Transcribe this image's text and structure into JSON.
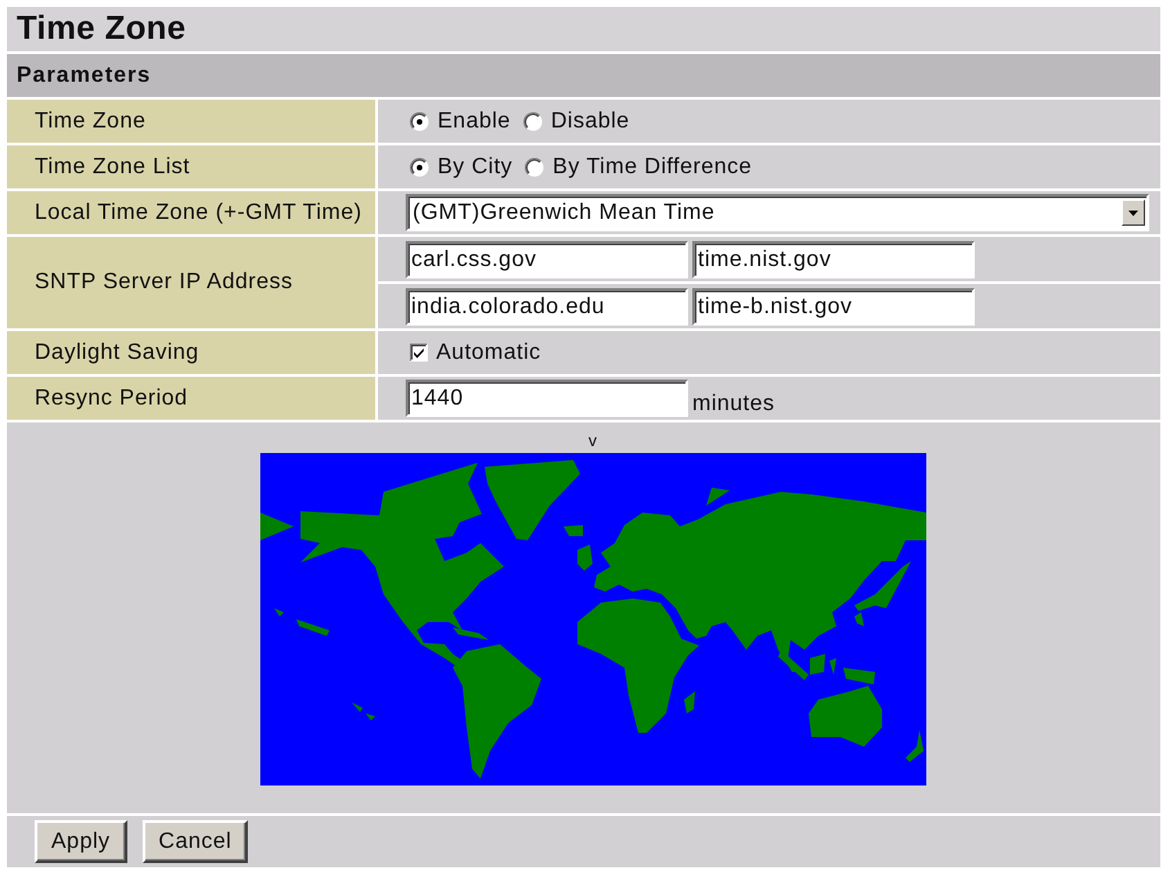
{
  "title": "Time Zone",
  "section": "Parameters",
  "rows": [
    {
      "kind": "radio",
      "label": "Time Zone",
      "options": [
        {
          "label": "Enable",
          "selected": true
        },
        {
          "label": "Disable",
          "selected": false
        }
      ]
    },
    {
      "kind": "radio",
      "label": "Time Zone List",
      "options": [
        {
          "label": "By City",
          "selected": true
        },
        {
          "label": "By Time Difference",
          "selected": false
        }
      ]
    },
    {
      "kind": "select",
      "label": "Local Time Zone (+-GMT Time)",
      "value": "(GMT)Greenwich Mean Time"
    },
    {
      "kind": "field_grid",
      "label": "SNTP Server IP Address",
      "lines": [
        [
          "carl.css.gov",
          "time.nist.gov"
        ],
        [
          "india.colorado.edu",
          "time-b.nist.gov"
        ]
      ]
    },
    {
      "kind": "checkbox",
      "label": "Daylight Saving",
      "option": "Automatic",
      "checked": true
    },
    {
      "kind": "field_unit",
      "label": "Resync Period",
      "value": "1440",
      "unit": "minutes"
    }
  ],
  "map": {
    "marker": "v"
  },
  "buttons": [
    "Apply",
    "Cancel"
  ]
}
